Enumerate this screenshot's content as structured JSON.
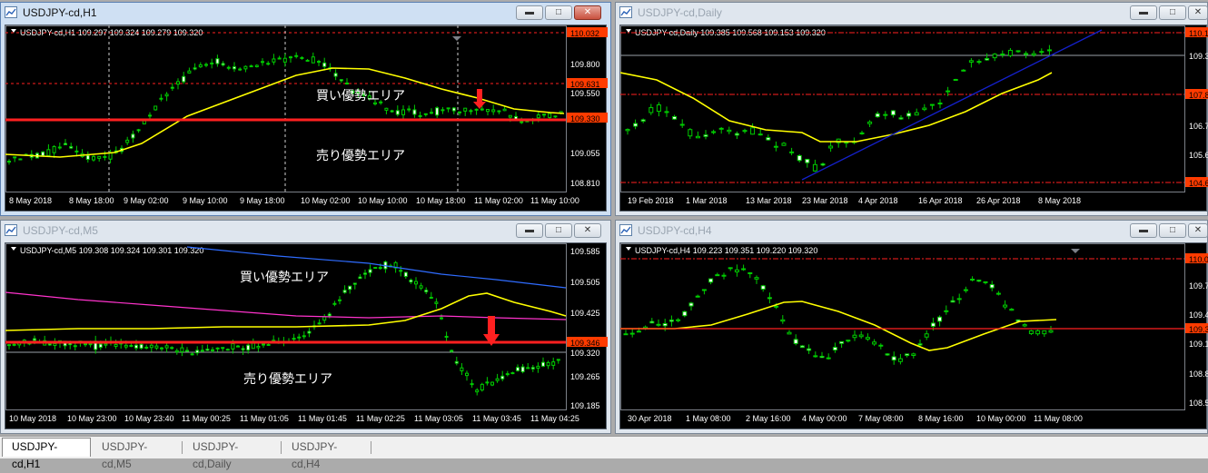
{
  "colors": {
    "candle": "#00cc00",
    "ma_yellow": "#ffff00",
    "ma_blue": "#2f6cff",
    "ma_magenta": "#ff33cc",
    "trend_navy": "#1420c8",
    "red_line": "#ff2020",
    "bid_line": "#9aa0a8",
    "axis_text": "#ffffff",
    "price_tag": "#ff3b00"
  },
  "windows": [
    {
      "id": "h1",
      "title": "USDJPY-cd,H1",
      "info": "USDJPY-cd,H1  109.297 109.324 109.279 109.320",
      "price_labels": [
        "110.032",
        "109.800",
        "109.631",
        "109.550",
        "109.330",
        "109.055",
        "108.810"
      ],
      "time_labels": [
        "8 May 2018",
        "8 May 18:00",
        "9 May 02:00",
        "9 May 10:00",
        "9 May 18:00",
        "10 May 02:00",
        "10 May 10:00",
        "10 May 18:00",
        "11 May 02:00",
        "11 May 10:00"
      ],
      "annotations": [
        "買い優勢エリア",
        "売り優勢エリア"
      ],
      "buttons": [
        "min",
        "max",
        "close"
      ]
    },
    {
      "id": "daily",
      "title": "USDJPY-cd,Daily",
      "info": "USDJPY-cd,Daily  109.385 109.568 109.153 109.320",
      "price_labels": [
        "110.1",
        "109.3",
        "107.8",
        "106.7",
        "105.6",
        "104.6"
      ],
      "time_labels": [
        "19 Feb 2018",
        "1 Mar 2018",
        "13 Mar 2018",
        "23 Mar 2018",
        "4 Apr 2018",
        "16 Apr 2018",
        "26 Apr 2018",
        "8 May 2018"
      ],
      "annotations": [],
      "buttons": [
        "min",
        "max",
        "close"
      ]
    },
    {
      "id": "m5",
      "title": "USDJPY-cd,M5",
      "info": "USDJPY-cd,M5  109.308 109.324 109.301 109.320",
      "price_labels": [
        "109.585",
        "109.505",
        "109.425",
        "109.346",
        "109.320",
        "109.265",
        "109.185"
      ],
      "time_labels": [
        "10 May 2018",
        "10 May 23:00",
        "10 May 23:40",
        "11 May 00:25",
        "11 May 01:05",
        "11 May 01:45",
        "11 May 02:25",
        "11 May 03:05",
        "11 May 03:45",
        "11 May 04:25"
      ],
      "annotations": [
        "買い優勢エリア",
        "売り優勢エリア"
      ],
      "buttons": [
        "min",
        "max",
        "close"
      ]
    },
    {
      "id": "h4",
      "title": "USDJPY-cd,H4",
      "info": "USDJPY-cd,H4  109.223 109.351 109.220 109.320",
      "price_labels": [
        "110.0",
        "109.7",
        "109.4",
        "109.3",
        "109.1",
        "108.8",
        "108.5"
      ],
      "time_labels": [
        "30 Apr 2018",
        "1 May 08:00",
        "2 May 16:00",
        "4 May 00:00",
        "7 May 08:00",
        "8 May 16:00",
        "10 May 00:00",
        "11 May 08:00"
      ],
      "annotations": [],
      "buttons": [
        "min",
        "max",
        "close"
      ]
    }
  ],
  "tabs": [
    "USDJPY-cd,H1",
    "USDJPY-cd,M5",
    "USDJPY-cd,Daily",
    "USDJPY-cd,H4"
  ],
  "active_tab": 0
}
